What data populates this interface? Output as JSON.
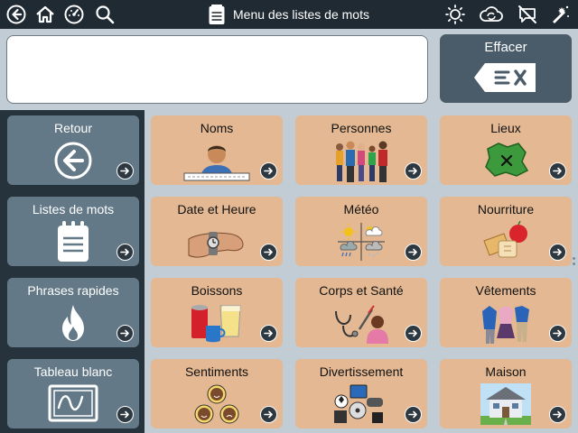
{
  "topbar": {
    "title": "Menu des listes de mots",
    "icons": [
      "back-circle-icon",
      "home-icon",
      "dashboard-icon",
      "search-icon",
      "brightness-icon",
      "sync-icon",
      "speech-off-icon",
      "edit-magic-icon"
    ]
  },
  "clear_button": {
    "label": "Effacer"
  },
  "sidebar": {
    "items": [
      {
        "label": "Retour",
        "icon": "back-circle-icon"
      },
      {
        "label": "Listes de mots",
        "icon": "notepad-icon"
      },
      {
        "label": "Phrases rapides",
        "icon": "flame-icon"
      },
      {
        "label": "Tableau blanc",
        "icon": "whiteboard-icon"
      }
    ]
  },
  "grid": {
    "tiles": [
      {
        "label": "Noms",
        "icon": "person-nametag-icon"
      },
      {
        "label": "Personnes",
        "icon": "people-group-icon"
      },
      {
        "label": "Lieux",
        "icon": "map-region-icon"
      },
      {
        "label": "Date et Heure",
        "icon": "wristwatch-icon"
      },
      {
        "label": "Météo",
        "icon": "weather-icon"
      },
      {
        "label": "Nourriture",
        "icon": "food-icon"
      },
      {
        "label": "Boissons",
        "icon": "drinks-icon"
      },
      {
        "label": "Corps et Santé",
        "icon": "doctor-stethoscope-icon"
      },
      {
        "label": "Vêtements",
        "icon": "clothes-rack-icon"
      },
      {
        "label": "Sentiments",
        "icon": "faces-icon"
      },
      {
        "label": "Divertissement",
        "icon": "entertainment-icon"
      },
      {
        "label": "Maison",
        "icon": "house-icon"
      }
    ]
  },
  "colors": {
    "topbar": "#1f2a33",
    "panel": "#c2ccd4",
    "sidebar_button": "#647987",
    "tile": "#e3b892",
    "clear_button": "#4a5c69"
  }
}
